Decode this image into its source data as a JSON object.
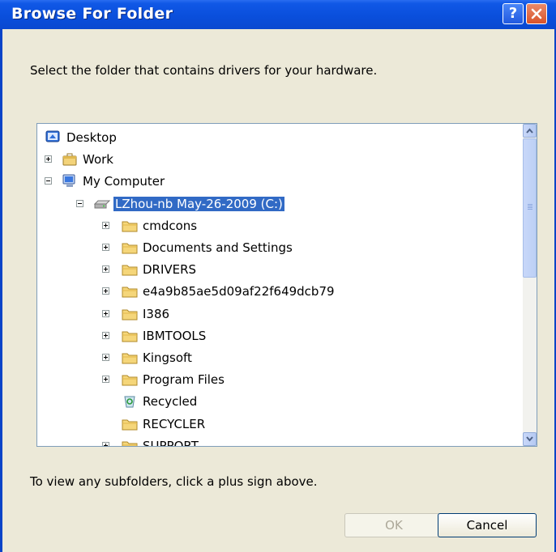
{
  "window": {
    "title": "Browse For Folder"
  },
  "title_buttons": {
    "help": "?",
    "close": "x"
  },
  "dialog": {
    "instruction": "Select the folder that contains drivers for your hardware.",
    "hint": "To view any subfolders, click a plus sign above."
  },
  "tree": [
    {
      "label": "Desktop",
      "icon": "desktop-icon",
      "expander": "none",
      "level": 0
    },
    {
      "label": "Work",
      "icon": "briefcase-icon",
      "expander": "plus",
      "level": 1
    },
    {
      "label": "My Computer",
      "icon": "computer-icon",
      "expander": "minus",
      "level": 1
    },
    {
      "label": "LZhou-nb May-26-2009 (C:)",
      "icon": "drive-icon",
      "expander": "minus",
      "level": 2,
      "selected": true
    },
    {
      "label": "cmdcons",
      "icon": "folder-icon",
      "expander": "plus",
      "level": 3
    },
    {
      "label": "Documents and Settings",
      "icon": "folder-icon",
      "expander": "plus",
      "level": 3
    },
    {
      "label": "DRIVERS",
      "icon": "folder-icon",
      "expander": "plus",
      "level": 3
    },
    {
      "label": "e4a9b85ae5d09af22f649dcb79",
      "icon": "folder-icon",
      "expander": "plus",
      "level": 3
    },
    {
      "label": "I386",
      "icon": "folder-icon",
      "expander": "plus",
      "level": 3
    },
    {
      "label": "IBMTOOLS",
      "icon": "folder-icon",
      "expander": "plus",
      "level": 3
    },
    {
      "label": "Kingsoft",
      "icon": "folder-icon",
      "expander": "plus",
      "level": 3
    },
    {
      "label": "Program Files",
      "icon": "folder-icon",
      "expander": "plus",
      "level": 3
    },
    {
      "label": "Recycled",
      "icon": "recycle-bin-icon",
      "expander": "none",
      "level": 3
    },
    {
      "label": "RECYCLER",
      "icon": "folder-icon",
      "expander": "none",
      "level": 3
    },
    {
      "label": "SUPPORT",
      "icon": "folder-icon",
      "expander": "plus",
      "level": 3
    }
  ],
  "buttons": {
    "ok": "OK",
    "cancel": "Cancel"
  },
  "colors": {
    "selection": "#316ac5",
    "titlebar": "#0a4fdc",
    "dialog_bg": "#ece9d8"
  }
}
